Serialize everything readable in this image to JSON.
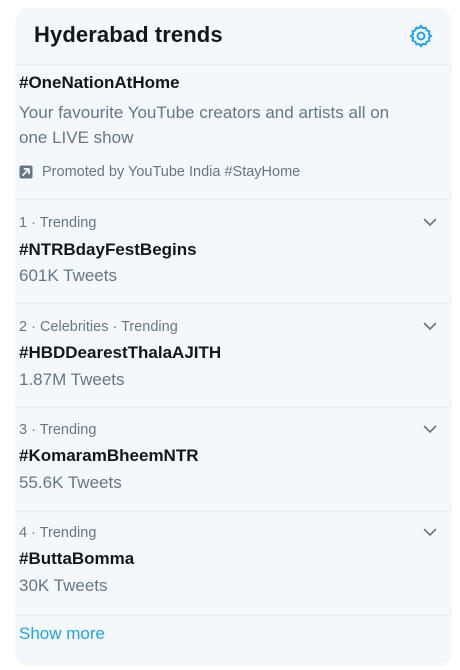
{
  "header": {
    "title": "Hyderabad trends",
    "settings_icon": "gear-icon"
  },
  "promoted": {
    "title": "#OneNationAtHome",
    "description": "Your favourite YouTube creators and artists all on one LIVE show",
    "promoted_by": "Promoted by YouTube India #StayHome",
    "icon": "promoted-arrow-icon"
  },
  "trends": [
    {
      "meta": "1 · Trending",
      "name": "#NTRBdayFestBegins",
      "count": "601K Tweets"
    },
    {
      "meta": "2 · Celebrities · Trending",
      "name": "#HBDDearestThalaAJITH",
      "count": "1.87M Tweets"
    },
    {
      "meta": "3 · Trending",
      "name": "#KomaramBheemNTR",
      "count": "55.6K Tweets"
    },
    {
      "meta": "4 · Trending",
      "name": "#ButtaBomma",
      "count": "30K Tweets"
    }
  ],
  "footer": {
    "show_more": "Show more"
  },
  "colors": {
    "accent": "#1da1f2",
    "panel_bg": "#f5f8fa",
    "primary_text": "#14171a",
    "secondary_text": "#657786",
    "divider": "#e6ecf0"
  }
}
